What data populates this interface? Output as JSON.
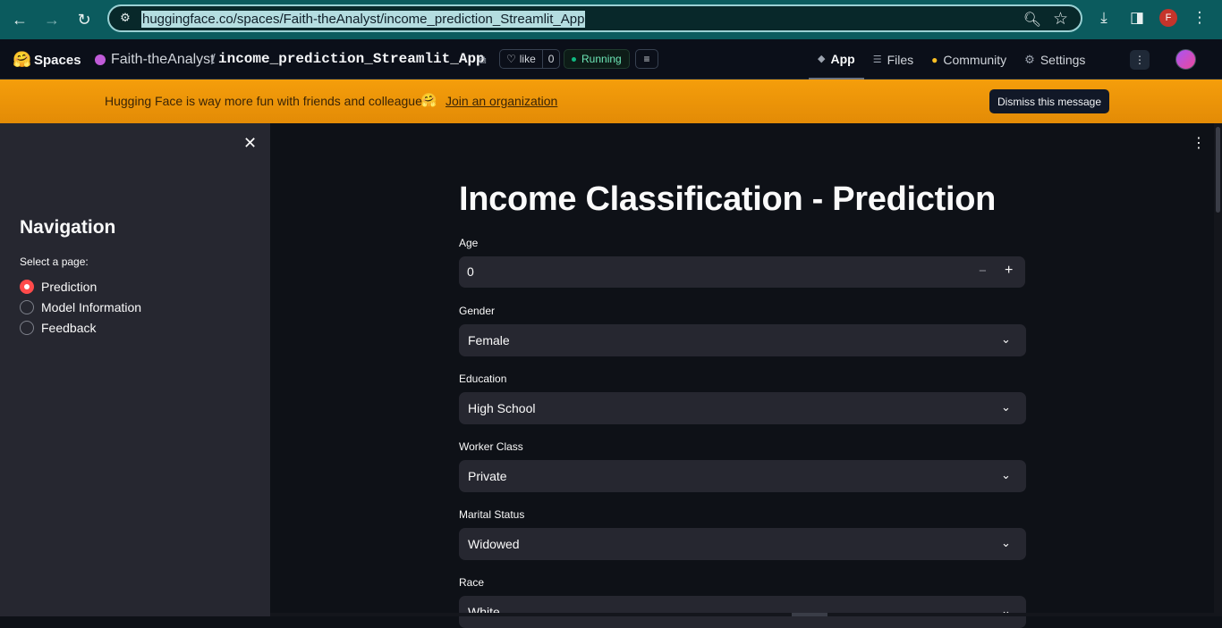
{
  "browser": {
    "url": "huggingface.co/spaces/Faith-theAnalyst/income_prediction_Streamlit_App",
    "profile_initial": "F"
  },
  "hf": {
    "brand": "Spaces",
    "owner": "Faith-theAnalyst",
    "slash": "/",
    "repo": "income_prediction_Streamlit_App",
    "like_label": "like",
    "like_count": "0",
    "status": "Running",
    "tabs": [
      {
        "label": "App",
        "icon": "cube-icon"
      },
      {
        "label": "Files",
        "icon": "files-icon"
      },
      {
        "label": "Community",
        "icon": "community-icon"
      },
      {
        "label": "Settings",
        "icon": "gear-icon"
      }
    ]
  },
  "banner": {
    "message": "Hugging Face is way more fun with friends and colleagues!",
    "link": "Join an organization",
    "dismiss": "Dismiss this message"
  },
  "sidebar": {
    "title": "Navigation",
    "prompt": "Select a page:",
    "options": [
      "Prediction",
      "Model Information",
      "Feedback"
    ],
    "selected": "Prediction"
  },
  "main": {
    "title": "Income Classification - Prediction",
    "age": {
      "label": "Age",
      "value": "0"
    },
    "fields": [
      {
        "label": "Gender",
        "value": "Female"
      },
      {
        "label": "Education",
        "value": "High School"
      },
      {
        "label": "Worker Class",
        "value": "Private"
      },
      {
        "label": "Marital Status",
        "value": "Widowed"
      },
      {
        "label": "Race",
        "value": "White"
      }
    ]
  },
  "colors": {
    "accent": "#ff4b4b",
    "banner": "#f59e0b",
    "chrome": "#0b5b5e"
  }
}
